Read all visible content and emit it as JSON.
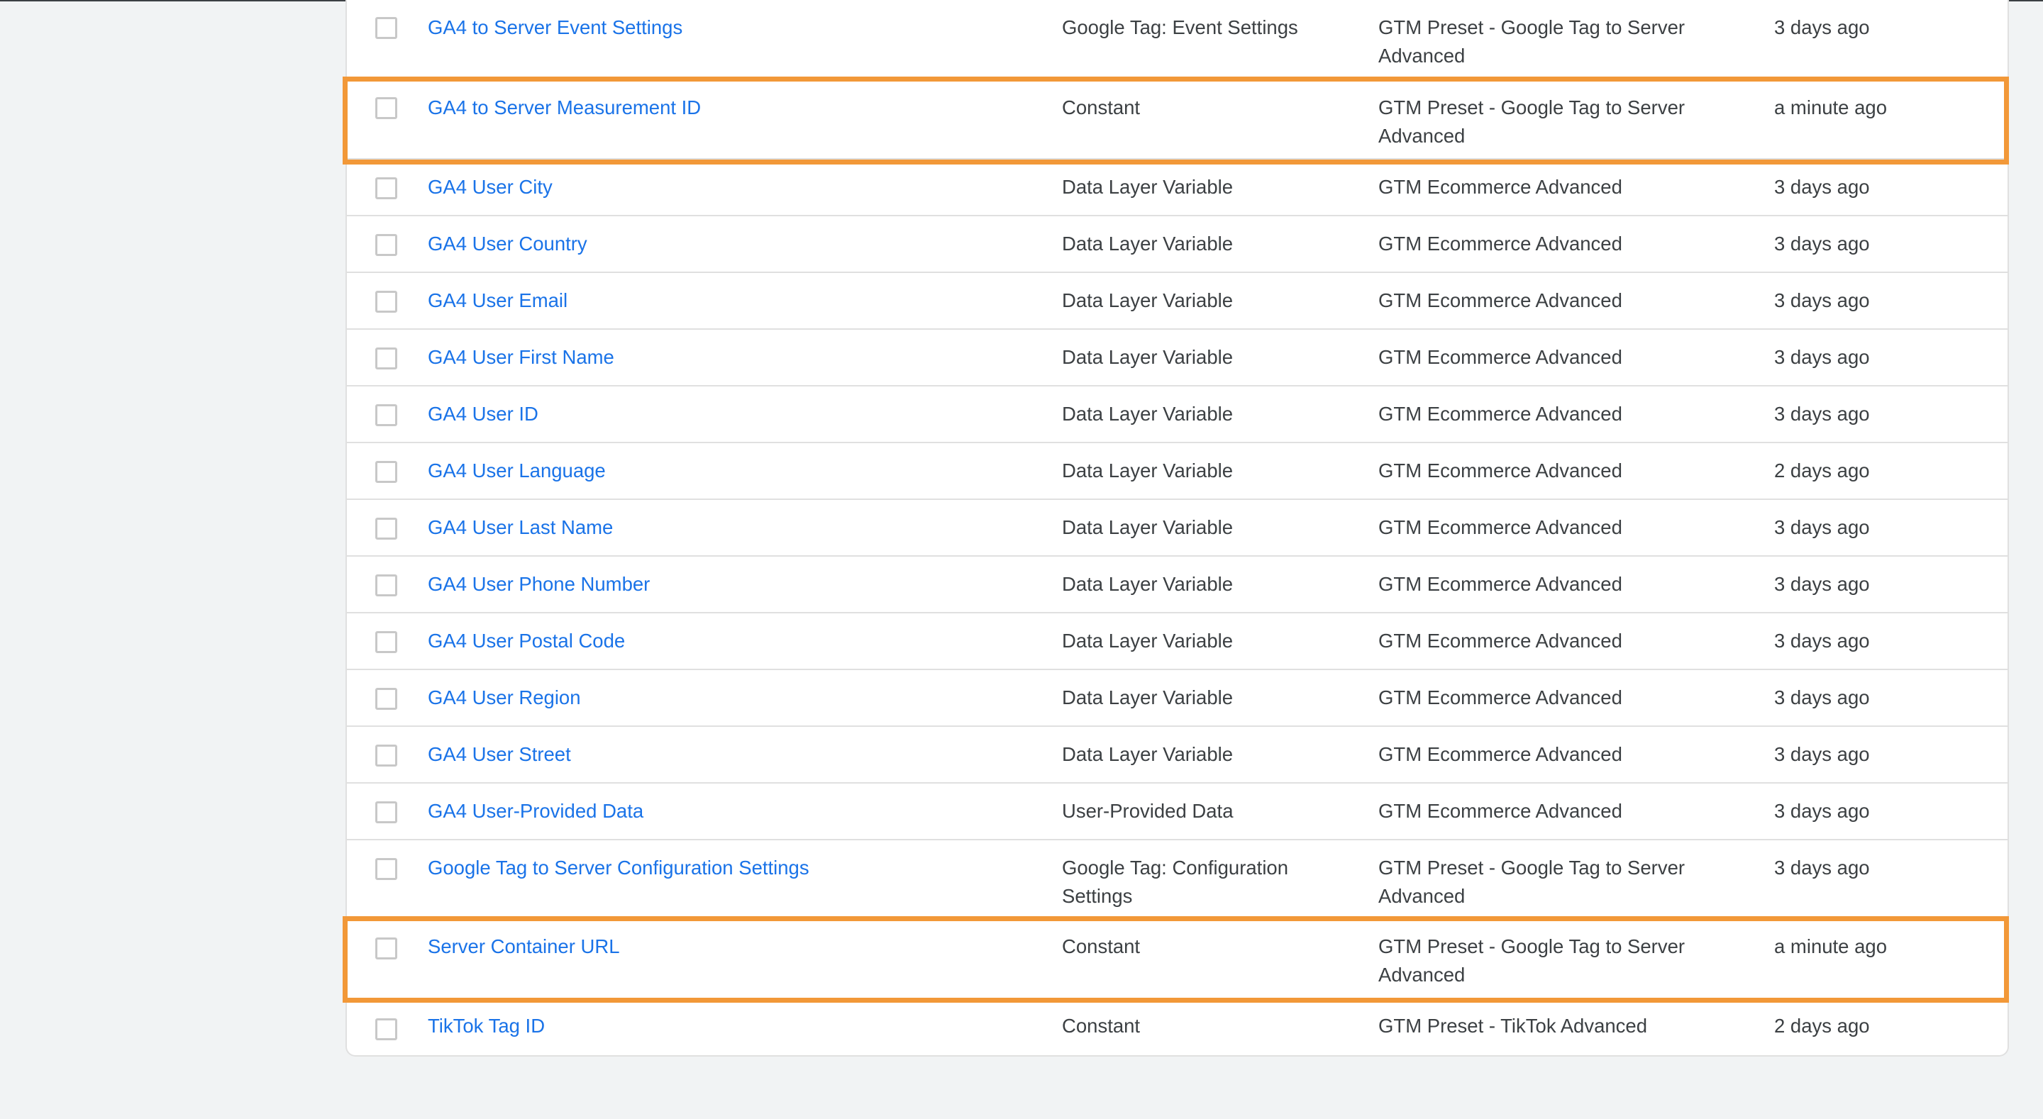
{
  "variables": [
    {
      "name": "GA4 to Server Event Settings",
      "type": "Google Tag: Event Settings",
      "folder": "GTM Preset - Google Tag to Server Advanced",
      "last_edited": "3 days ago"
    },
    {
      "name": "GA4 to Server Measurement ID",
      "type": "Constant",
      "folder": "GTM Preset - Google Tag to Server Advanced",
      "last_edited": "a minute ago"
    },
    {
      "name": "GA4 User City",
      "type": "Data Layer Variable",
      "folder": "GTM Ecommerce Advanced",
      "last_edited": "3 days ago"
    },
    {
      "name": "GA4 User Country",
      "type": "Data Layer Variable",
      "folder": "GTM Ecommerce Advanced",
      "last_edited": "3 days ago"
    },
    {
      "name": "GA4 User Email",
      "type": "Data Layer Variable",
      "folder": "GTM Ecommerce Advanced",
      "last_edited": "3 days ago"
    },
    {
      "name": "GA4 User First Name",
      "type": "Data Layer Variable",
      "folder": "GTM Ecommerce Advanced",
      "last_edited": "3 days ago"
    },
    {
      "name": "GA4 User ID",
      "type": "Data Layer Variable",
      "folder": "GTM Ecommerce Advanced",
      "last_edited": "3 days ago"
    },
    {
      "name": "GA4 User Language",
      "type": "Data Layer Variable",
      "folder": "GTM Ecommerce Advanced",
      "last_edited": "2 days ago"
    },
    {
      "name": "GA4 User Last Name",
      "type": "Data Layer Variable",
      "folder": "GTM Ecommerce Advanced",
      "last_edited": "3 days ago"
    },
    {
      "name": "GA4 User Phone Number",
      "type": "Data Layer Variable",
      "folder": "GTM Ecommerce Advanced",
      "last_edited": "3 days ago"
    },
    {
      "name": "GA4 User Postal Code",
      "type": "Data Layer Variable",
      "folder": "GTM Ecommerce Advanced",
      "last_edited": "3 days ago"
    },
    {
      "name": "GA4 User Region",
      "type": "Data Layer Variable",
      "folder": "GTM Ecommerce Advanced",
      "last_edited": "3 days ago"
    },
    {
      "name": "GA4 User Street",
      "type": "Data Layer Variable",
      "folder": "GTM Ecommerce Advanced",
      "last_edited": "3 days ago"
    },
    {
      "name": "GA4 User-Provided Data",
      "type": "User-Provided Data",
      "folder": "GTM Ecommerce Advanced",
      "last_edited": "3 days ago"
    },
    {
      "name": "Google Tag to Server Configuration Settings",
      "type": "Google Tag: Configuration Settings",
      "folder": "GTM Preset - Google Tag to Server Advanced",
      "last_edited": "3 days ago"
    },
    {
      "name": "Server Container URL",
      "type": "Constant",
      "folder": "GTM Preset - Google Tag to Server Advanced",
      "last_edited": "a minute ago"
    },
    {
      "name": "TikTok Tag ID",
      "type": "Constant",
      "folder": "GTM Preset - TikTok Advanced",
      "last_edited": "2 days ago"
    }
  ],
  "highlighted_rows": [
    "GA4 to Server Measurement ID",
    "Server Container URL"
  ],
  "colors": {
    "page_background": "#f1f3f4",
    "card_background": "#ffffff",
    "link": "#1a73e8",
    "text": "#3c4043",
    "divider": "#e0e0e0",
    "highlight_border": "#f29838"
  }
}
